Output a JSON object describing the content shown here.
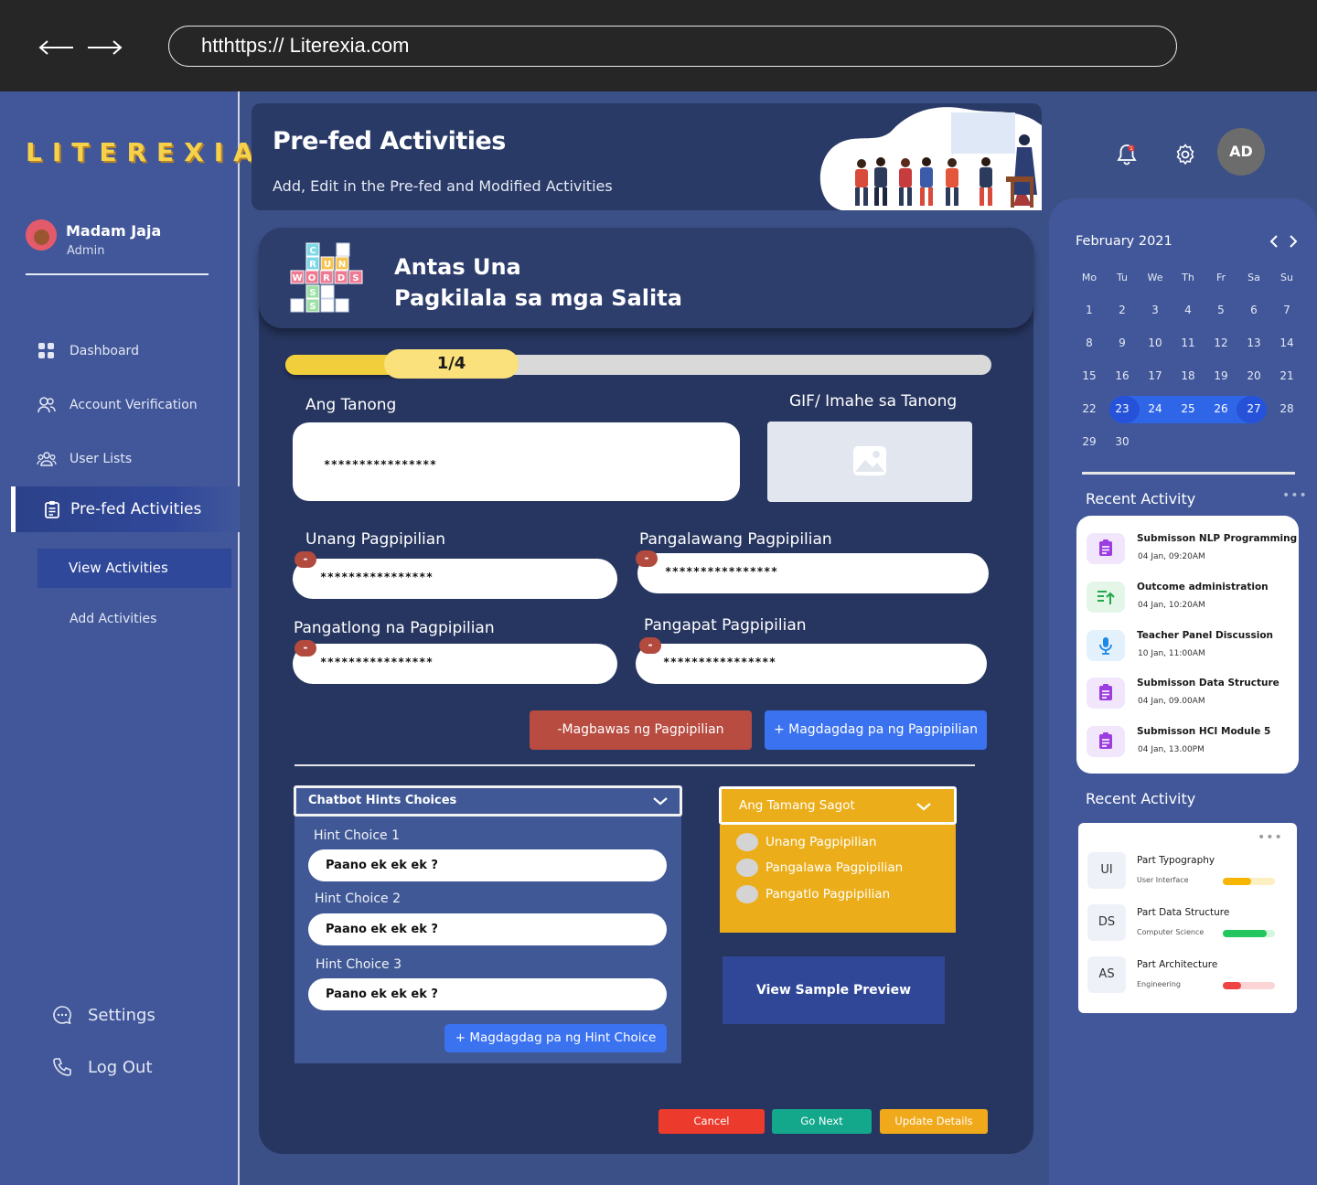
{
  "browser": {
    "url": "htthttps:// Literexia.com"
  },
  "sidebar": {
    "logo": "LITEREXIA",
    "user": {
      "name": "Madam Jaja",
      "role": "Admin"
    },
    "nav": [
      {
        "label": "Dashboard"
      },
      {
        "label": "Account Verification"
      },
      {
        "label": "User Lists"
      },
      {
        "label": "Pre-fed Activities"
      }
    ],
    "sub_nav": [
      {
        "label": "View Activities"
      },
      {
        "label": "Add Activities"
      }
    ],
    "footer": {
      "settings": "Settings",
      "logout": "Log Out"
    }
  },
  "banner": {
    "title": "Pre-fed Activities",
    "subtitle": "Add, Edit in the Pre-fed and Modified Activities"
  },
  "topbar": {
    "avatar_initials": "AD",
    "notification_count": "1"
  },
  "activity": {
    "level": "Antas Una",
    "topic": "Pagkilala sa mga Salita",
    "word_logo": [
      "C",
      "R",
      "U",
      "N",
      "W",
      "O",
      "R",
      "D",
      "S",
      "S",
      "S"
    ],
    "progress": {
      "label": "1/4",
      "value": 0.25
    },
    "question_label": "Ang Tanong",
    "question_value": "****************",
    "image_label": "GIF/ Imahe sa Tanong",
    "choices": [
      {
        "label": "Unang Pagpipilian",
        "value": "****************"
      },
      {
        "label": "Pangalawang Pagpipilian",
        "value": "****************"
      },
      {
        "label": "Pangatlong na Pagpipilian",
        "value": "****************"
      },
      {
        "label": "Pangapat Pagpipilian",
        "value": "****************"
      }
    ],
    "minus_symbol": "-",
    "remove_choice_button": "-Magbawas ng Pagpipilian",
    "add_choice_button": "+ Magdagdag pa ng Pagpipilian",
    "hints": {
      "header": "Chatbot Hints Choices",
      "items": [
        {
          "label": "Hint Choice 1",
          "value": "Paano ek ek ek ?"
        },
        {
          "label": "Hint Choice 2",
          "value": "Paano ek ek ek ?"
        },
        {
          "label": "Hint Choice 3",
          "value": "Paano ek ek ek ?"
        }
      ],
      "add_button": "+ Magdagdag pa ng Hint Choice"
    },
    "answer": {
      "header": "Ang Tamang Sagot",
      "options": [
        "Unang Pagpipilian",
        "Pangalawa Pagpipilian",
        "Pangatlo Pagpipilian"
      ]
    },
    "preview_button": "View Sample Preview",
    "actions": {
      "cancel": "Cancel",
      "next": "Go Next",
      "update": "Update Details"
    }
  },
  "calendar": {
    "month": "February 2021",
    "weekdays": [
      "Mo",
      "Tu",
      "We",
      "Th",
      "Fr",
      "Sa",
      "Su"
    ],
    "weeks": [
      [
        "1",
        "2",
        "3",
        "4",
        "5",
        "6",
        "7"
      ],
      [
        "8",
        "9",
        "10",
        "11",
        "12",
        "13",
        "14"
      ],
      [
        "15",
        "16",
        "17",
        "18",
        "19",
        "20",
        "21"
      ],
      [
        "22",
        "23",
        "24",
        "25",
        "26",
        "27",
        "28"
      ],
      [
        "29",
        "30",
        "",
        "",
        "",
        "",
        ""
      ]
    ],
    "selected_range": [
      "23",
      "27"
    ]
  },
  "recent_activity": {
    "title": "Recent Activity",
    "items": [
      {
        "title": "Submisson NLP Programming",
        "time": "04 Jan, 09:20AM",
        "icon": "clipboard-icon",
        "color": "#9b3de0"
      },
      {
        "title": "Outcome administration",
        "time": "04 Jan, 10:20AM",
        "icon": "upload-list-icon",
        "color": "#22a84a"
      },
      {
        "title": "Teacher Panel Discussion",
        "time": "10 Jan, 11:00AM",
        "icon": "microphone-icon",
        "color": "#1e88e5"
      },
      {
        "title": "Submisson Data Structure",
        "time": "04 Jan, 09.00AM",
        "icon": "clipboard-icon",
        "color": "#9b3de0"
      },
      {
        "title": "Submisson HCI Module 5",
        "time": "04 Jan, 13.00PM",
        "icon": "clipboard-icon",
        "color": "#9b3de0"
      }
    ]
  },
  "recent_activity_2": {
    "title": "Recent Activity",
    "items": [
      {
        "tag": "UI",
        "title": "Part Typography",
        "subtitle": "User Interface",
        "progress": 0.55,
        "color": "#f5b500",
        "track": "#fcefc2"
      },
      {
        "tag": "DS",
        "title": "Part Data Structure",
        "subtitle": "Computer Science",
        "progress": 0.85,
        "color": "#22c55e",
        "track": "#d4f5dd"
      },
      {
        "tag": "AS",
        "title": "Part Architecture",
        "subtitle": "Engineering",
        "progress": 0.35,
        "color": "#ef4444",
        "track": "#fbd5d5"
      }
    ]
  }
}
